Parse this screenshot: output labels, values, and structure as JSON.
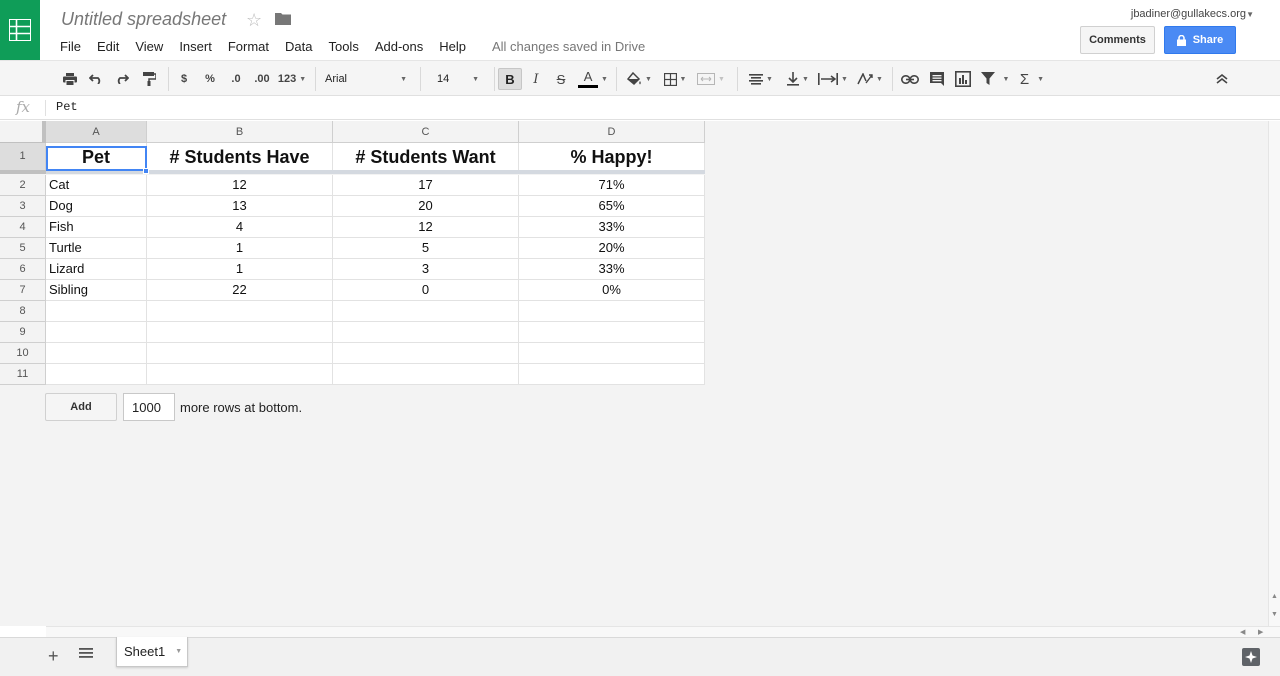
{
  "header": {
    "title": "Untitled spreadsheet",
    "account": "jbadiner@gullakecs.org",
    "comments_label": "Comments",
    "share_label": "Share",
    "save_status": "All changes saved in Drive",
    "menu": [
      "File",
      "Edit",
      "View",
      "Insert",
      "Format",
      "Data",
      "Tools",
      "Add-ons",
      "Help"
    ]
  },
  "toolbar": {
    "currency_label": "$",
    "percent_label": "%",
    "dec_decrease_label": ".0",
    "dec_increase_label": ".00",
    "more_formats_label": "123",
    "font": "Arial",
    "font_size": "14",
    "bold_label": "B",
    "italic_label": "I",
    "strike_label": "S",
    "text_color_label": "A",
    "sum_label": "Σ",
    "text_color": "#000000"
  },
  "formula_bar": {
    "fx_label": "fx",
    "value": "Pet"
  },
  "grid": {
    "selected_cell": "A1",
    "columns": [
      "A",
      "B",
      "C",
      "D"
    ],
    "row_numbers": [
      "1",
      "2",
      "3",
      "4",
      "5",
      "6",
      "7",
      "8",
      "9",
      "10",
      "11"
    ],
    "header_row": [
      "Pet",
      "# Students Have",
      "# Students Want",
      "% Happy!"
    ],
    "rows": [
      [
        "Cat",
        "12",
        "17",
        "71%"
      ],
      [
        "Dog",
        "13",
        "20",
        "65%"
      ],
      [
        "Fish",
        "4",
        "12",
        "33%"
      ],
      [
        "Turtle",
        "1",
        "5",
        "20%"
      ],
      [
        "Lizard",
        "1",
        "3",
        "33%"
      ],
      [
        "Sibling",
        "22",
        "0",
        "0%"
      ]
    ]
  },
  "add_rows": {
    "button_label": "Add",
    "count": "1000",
    "suffix": "more rows at bottom."
  },
  "sheets": {
    "tabs": [
      "Sheet1"
    ],
    "active": "Sheet1"
  },
  "colors": {
    "brand_green": "#0f9d58",
    "share_blue": "#4a8af4",
    "selection_blue": "#4285f4"
  }
}
